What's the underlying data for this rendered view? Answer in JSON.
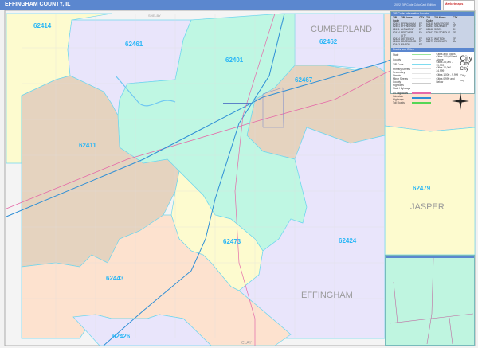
{
  "header": {
    "title": "EFFINGHAM COUNTY, IL",
    "edition": "2022 ZIP Code ColorCast Edition",
    "brand": "Marketmaps"
  },
  "colors": {
    "yellow": "#fdfbcf",
    "lavender": "#e9e5fb",
    "mint": "#bff7e3",
    "tan": "#e5d3bf",
    "peach": "#fde2cf",
    "zip_label": "#29b6f6"
  },
  "zip_labels": {
    "z62414": "62414",
    "z62461": "62461",
    "z62401": "62401",
    "z62467": "62467",
    "z62462": "62462",
    "z62411": "62411",
    "z62479": "62479",
    "z62473": "62473",
    "z62424": "62424",
    "z62443": "62443",
    "z62426": "62426"
  },
  "counties": {
    "cumberland": "CUMBERLAND",
    "jasper": "JASPER",
    "effingham": "EFFINGHAM",
    "shelby": "SHELBY",
    "clay": "CLAY"
  },
  "legend": {
    "zip_table_title": "ZIP Code Information Locator",
    "headers": [
      "ZIP Code",
      "ZIP Name",
      "CTY",
      "ZIP Code",
      "ZIP Name",
      "CTY"
    ],
    "rows": [
      [
        "62401",
        "EFFINGHAM",
        "EF",
        "62445",
        "MONTROSE",
        "CU"
      ],
      [
        "62401",
        "EFFINGHAM",
        "EF",
        "62461",
        "SHUMWAY",
        "EF"
      ],
      [
        "62411",
        "ALTAMONT",
        "EF",
        "62462",
        "SIGEL",
        "SH"
      ],
      [
        "62414",
        "BEECHER CITY",
        "FA",
        "62467",
        "TEUTOPOLIS",
        "EF"
      ],
      [
        "62424",
        "DIETERICH",
        "EF",
        "62473",
        "WATSON",
        "EF"
      ],
      [
        "62426",
        "EDGEWOOD",
        "EF",
        "62479",
        "WHEELER",
        "JA"
      ],
      [
        "62443",
        "MASON",
        "EF",
        "",
        "",
        ""
      ]
    ],
    "roads_title": "Roads and Cities",
    "roads": [
      "State",
      "County",
      "ZIP Code",
      "Primary Streets",
      "Secondary Streets",
      "Minor Streets",
      "County Highways",
      "State Highways",
      "US Highways",
      "Interstate Highways",
      "Toll Roads"
    ],
    "cities_title": "Cities and Towns",
    "cities": [
      "Cities 100,000 and Above",
      "Cities 25,000 - 99,999",
      "Cities 10,000 - 24,999",
      "Cities 1,000 - 9,999",
      "Cities 0,999 and Below"
    ],
    "city_sample": "City"
  }
}
